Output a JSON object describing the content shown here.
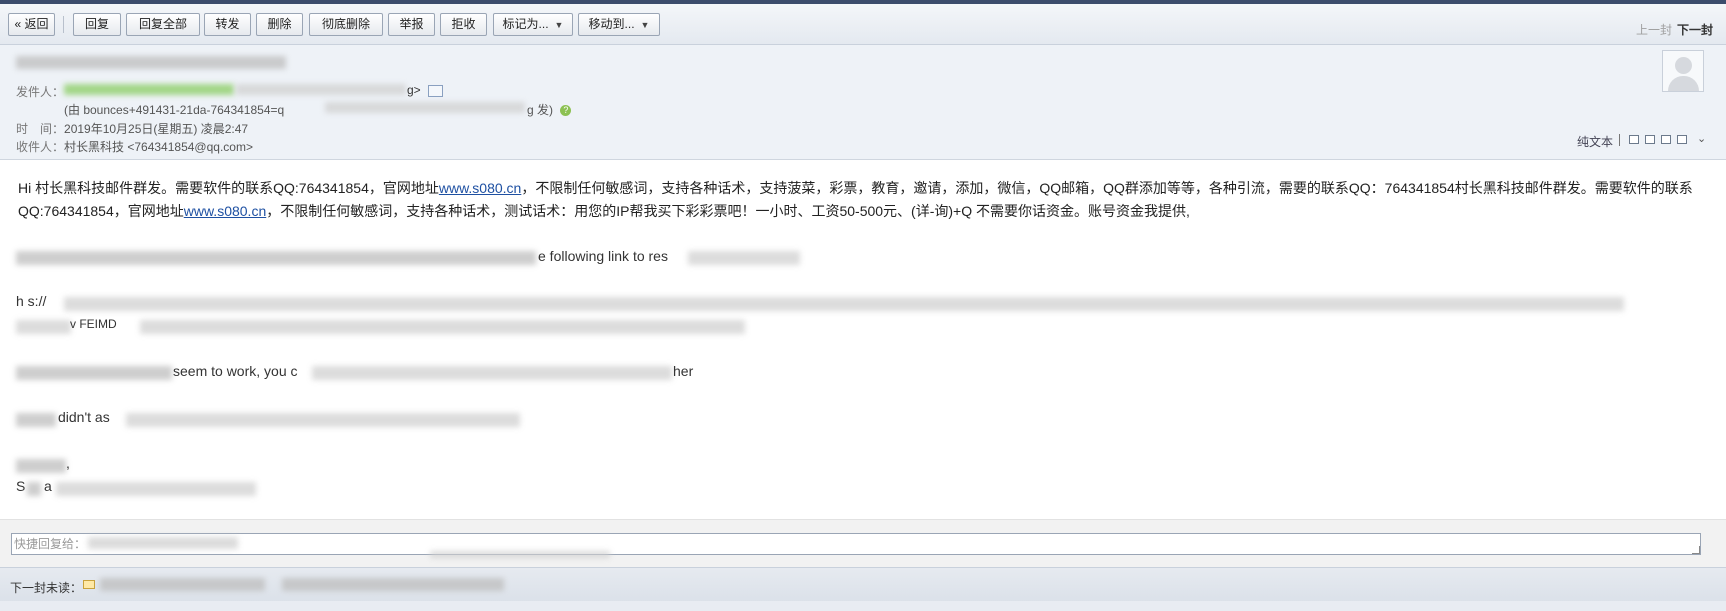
{
  "toolbar": {
    "back": "« 返回",
    "reply": "回复",
    "reply_all": "回复全部",
    "forward": "转发",
    "delete": "删除",
    "delete_permanently": "彻底删除",
    "report": "举报",
    "reject": "拒收",
    "mark_as": "标记为...",
    "move_to": "移动到...",
    "prev": "上一封",
    "next": "下一封"
  },
  "header": {
    "sender_label": "发件人：",
    "sender_suffix": "g>",
    "via_prefix": "(由 bounces+491431-21da-764341854=q",
    "via_suffix": "g  发)",
    "time_label": "时　间：",
    "time_value": "2019年10月25日(星期五) 凌晨2:47",
    "recipient_label": "收件人：",
    "recipient_value": "村长黑科技 <764341854@qq.com>",
    "plain_text": "纯文本"
  },
  "body": {
    "p1_a": "Hi 村长黑科技邮件群发。需要软件的联系QQ:764341854，官网地址",
    "p1_link1": "www.s080.cn",
    "p1_b": "，不限制任何敏感词，支持各种话术，支持菠菜，彩票，教育，邀请，添加，微信，QQ邮箱，QQ群添加等等，各种引流，需要的联系QQ：764341854村长黑科技邮件群发。需要软件的联系QQ:764341854，官网地址",
    "p1_link2": "www.s080.cn",
    "p1_c": "，不限制任何敏感词，支持各种话术，测试话术：用您的IP帮我买下彩彩票吧！一小时、工资50-500元、(详-询)+Q 不需要你话资金。账号资金我提供,",
    "frag_following": "e following link to res",
    "frag_https": "h  s://",
    "frag_code": "v FEIMD",
    "frag_seem": "seem to work, you c",
    "frag_her": "her",
    "frag_didnt": "didn't as",
    "frag_comma": ",",
    "frag_s": "S",
    "frag_a": "a"
  },
  "reply": {
    "placeholder": "快捷回复给："
  },
  "next_unread": {
    "label": "下一封未读："
  }
}
